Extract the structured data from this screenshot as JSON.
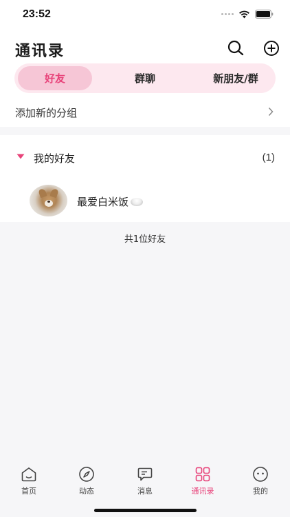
{
  "status_bar": {
    "time": "23:52"
  },
  "header": {
    "title": "通讯录",
    "search_icon": "search-icon",
    "add_icon": "plus-circle-icon"
  },
  "tabs": [
    {
      "label": "好友",
      "active": true
    },
    {
      "label": "群聊",
      "active": false
    },
    {
      "label": "新朋友/群",
      "active": false
    }
  ],
  "add_group": {
    "label": "添加新的分组"
  },
  "friend_group": {
    "name": "我的好友",
    "count": "(1)",
    "friends": [
      {
        "name": "最爱白米饭",
        "emoji": "rice-icon"
      }
    ]
  },
  "total": "共1位好友",
  "tab_bar": [
    {
      "label": "首页",
      "icon": "home-icon",
      "active": false
    },
    {
      "label": "动态",
      "icon": "compass-icon",
      "active": false
    },
    {
      "label": "消息",
      "icon": "message-icon",
      "active": false
    },
    {
      "label": "通讯录",
      "icon": "grid-icon",
      "active": true
    },
    {
      "label": "我的",
      "icon": "smiley-icon",
      "active": false
    }
  ],
  "colors": {
    "accent": "#e8437a",
    "tab_bg": "#fde8ef",
    "tab_active_bg": "#f6c6d6"
  }
}
